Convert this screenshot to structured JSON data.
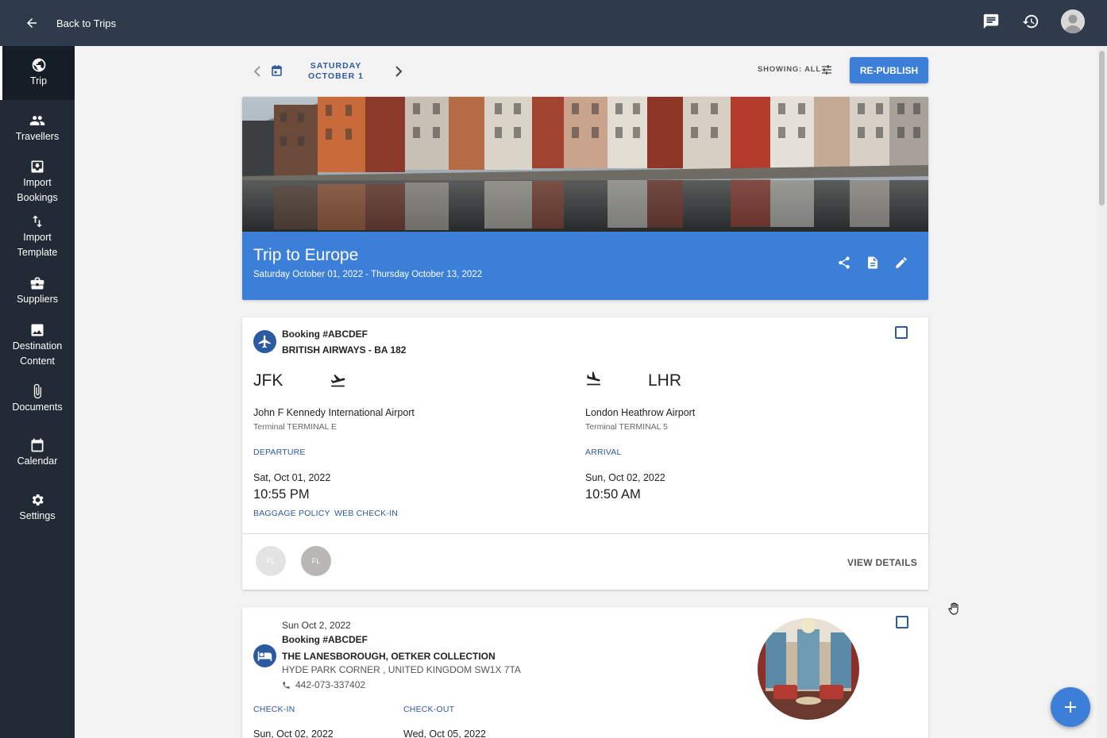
{
  "header": {
    "back_label": "Back to Trips",
    "icons": [
      "arrow-left-icon",
      "chat-icon",
      "history-icon",
      "avatar"
    ]
  },
  "sidebar": {
    "items": [
      {
        "label": "Trip",
        "icon": "globe-icon",
        "active": true
      },
      {
        "label": "Travellers",
        "icon": "people-icon"
      },
      {
        "label": "Import Bookings",
        "icon": "import-icon"
      },
      {
        "label": "Import Template",
        "icon": "swap-vertical-icon"
      },
      {
        "label": "Suppliers",
        "icon": "briefcase-icon"
      },
      {
        "label": "Destination Content",
        "icon": "image-icon"
      },
      {
        "label": "Documents",
        "icon": "paperclip-icon"
      },
      {
        "label": "Calendar",
        "icon": "calendar-icon"
      },
      {
        "label": "Settings",
        "icon": "gear-icon"
      }
    ]
  },
  "toolbar": {
    "day": "SATURDAY",
    "date": "OCTOBER 1",
    "showing_label": "SHOWING: ALL",
    "republish_label": "RE-PUBLISH"
  },
  "trip": {
    "title": "Trip to Europe",
    "dates": "Saturday October 01, 2022 - Thursday October 13, 2022"
  },
  "flight": {
    "booking": "Booking #ABCDEF",
    "carrier": "BRITISH AIRWAYS - BA 182",
    "origin": {
      "code": "JFK",
      "airport": "John F Kennedy International Airport",
      "terminal": "Terminal TERMINAL E",
      "label": "DEPARTURE",
      "date": "Sat, Oct 01, 2022",
      "time": "10:55 PM"
    },
    "destination": {
      "code": "LHR",
      "airport": "London Heathrow Airport",
      "terminal": "Terminal TERMINAL 5",
      "label": "ARRIVAL",
      "date": "Sun, Oct 02, 2022",
      "time": "10:50 AM"
    },
    "links": [
      "BAGGAGE POLICY",
      "WEB CHECK-IN"
    ],
    "travellers": [
      "FL",
      "FL"
    ],
    "view_details": "VIEW DETAILS"
  },
  "hotel": {
    "date": "Sun Oct 2, 2022",
    "booking": "Booking #ABCDEF",
    "name": "THE LANESBOROUGH, OETKER COLLECTION",
    "address": "HYDE PARK CORNER , UNITED KINGDOM SW1X 7TA",
    "phone": "442-073-337402",
    "checkin_label": "CHECK-IN",
    "checkout_label": "CHECK-OUT",
    "checkin_date": "Sun, Oct 02, 2022",
    "checkout_date": "Wed, Oct 05, 2022"
  },
  "colors": {
    "topbar": "#2f3a4a",
    "sidebar": "#222a36",
    "accent": "#3b7fd9",
    "link": "#2c5aa0"
  }
}
